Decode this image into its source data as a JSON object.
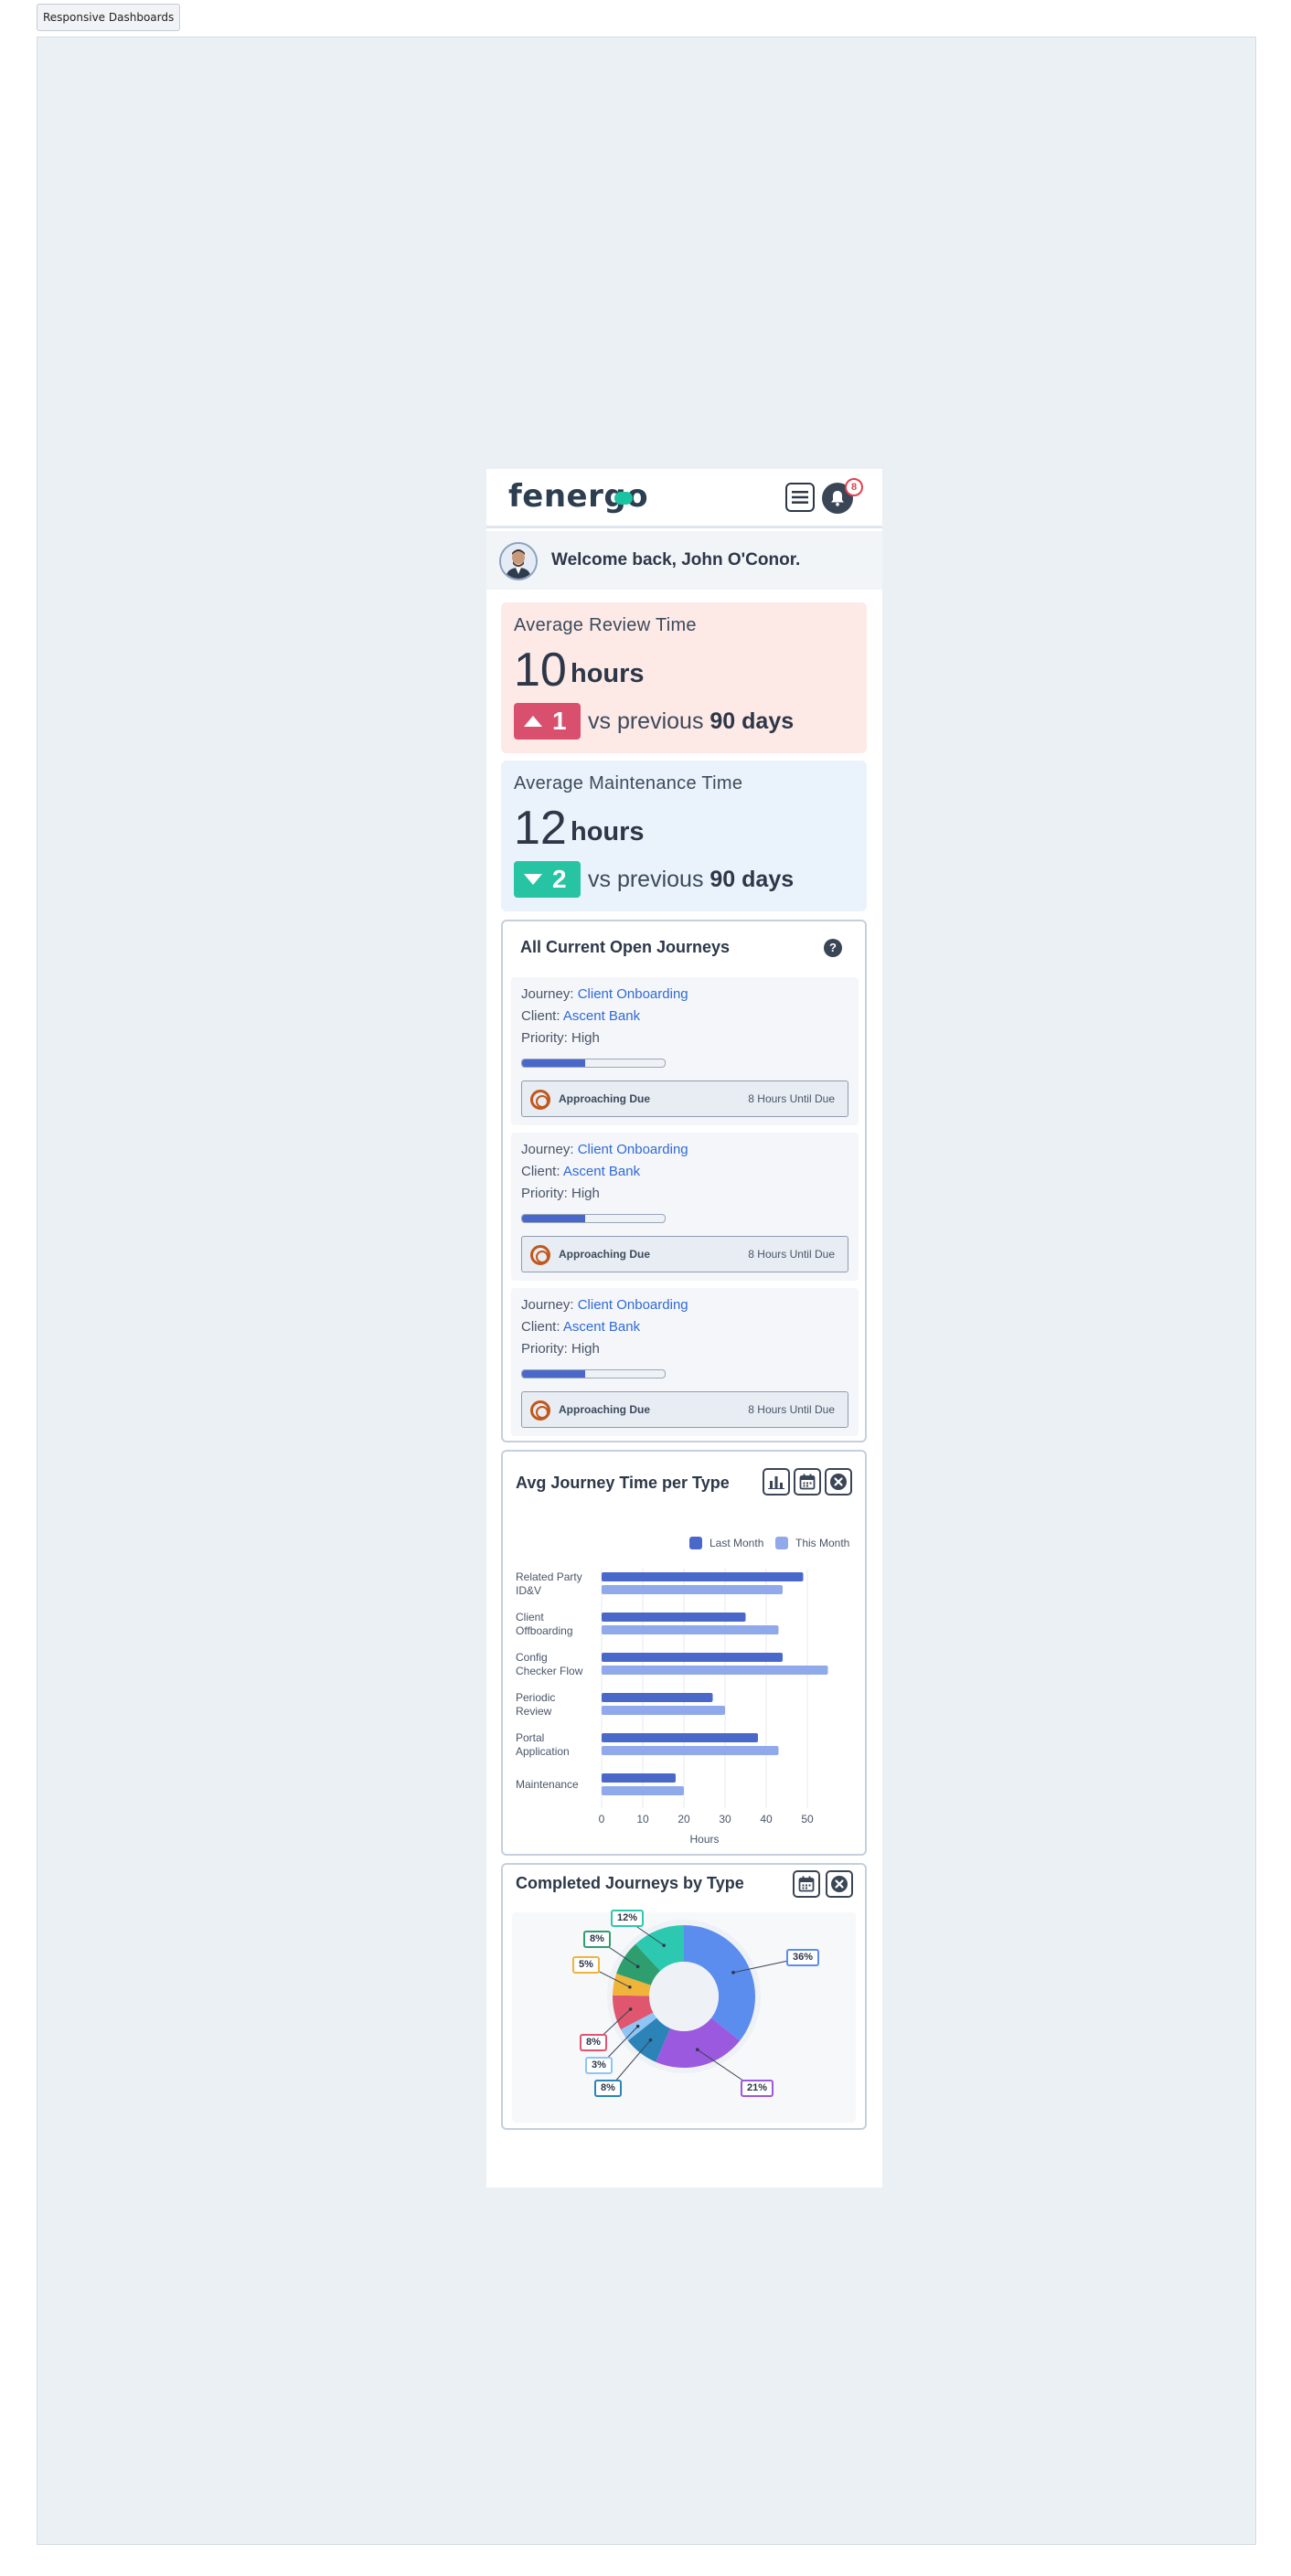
{
  "story_tab": "Responsive Dashboards",
  "header": {
    "logo": "fenergo",
    "notification_count": "8"
  },
  "welcome": {
    "text": "Welcome back, John O'Conor."
  },
  "kpis": [
    {
      "title": "Average Review Time",
      "value": "10",
      "unit": "hours",
      "delta": "1",
      "direction": "up",
      "compare_prefix": "vs previous",
      "compare_bold": "90 days",
      "color": "#d9506f"
    },
    {
      "title": "Average Maintenance Time",
      "value": "12",
      "unit": "hours",
      "delta": "2",
      "direction": "down",
      "compare_prefix": "vs previous",
      "compare_bold": "90 days",
      "color": "#27c4a4"
    }
  ],
  "journeys": {
    "title": "All Current Open Journeys",
    "help": "?",
    "items": [
      {
        "journey_label": "Journey:",
        "journey": "Client Onboarding",
        "client_label": "Client:",
        "client": "Ascent Bank",
        "priority": "Priority: High",
        "progress": 0.44,
        "status": "Approaching Due",
        "time_left": "8 Hours Until Due"
      },
      {
        "journey_label": "Journey:",
        "journey": "Client Onboarding",
        "client_label": "Client:",
        "client": "Ascent Bank",
        "priority": "Priority: High",
        "progress": 0.44,
        "status": "Approaching Due",
        "time_left": "8 Hours Until Due"
      },
      {
        "journey_label": "Journey:",
        "journey": "Client Onboarding",
        "client_label": "Client:",
        "client": "Ascent Bank",
        "priority": "Priority: High",
        "progress": 0.44,
        "status": "Approaching Due",
        "time_left": "8 Hours Until Due"
      }
    ]
  },
  "avg_panel": {
    "title": "Avg Journey Time per Type"
  },
  "completed_panel": {
    "title": "Completed Journeys by Type"
  },
  "chart_data": [
    {
      "type": "bar",
      "orientation": "horizontal",
      "title": "Avg Journey Time per Type",
      "categories": [
        "Related Party ID&V",
        "Client Offboarding",
        "Config Checker Flow",
        "Periodic Review",
        "Portal Application",
        "Maintenance"
      ],
      "category_lines": [
        [
          "Related Party",
          "ID&V"
        ],
        [
          "Client",
          "Offboarding"
        ],
        [
          "Config",
          "Checker Flow"
        ],
        [
          "Periodic",
          "Review"
        ],
        [
          "Portal",
          "Application"
        ],
        [
          "Maintenance"
        ]
      ],
      "series": [
        {
          "name": "Last Month",
          "values": [
            49,
            35,
            44,
            27,
            38,
            18
          ],
          "color": "#4a68c9"
        },
        {
          "name": "This Month",
          "values": [
            44,
            43,
            55,
            30,
            43,
            20
          ],
          "color": "#8fa9ea"
        }
      ],
      "xlabel": "Hours",
      "xlim": [
        0,
        50
      ],
      "xticks": [
        "0",
        "10",
        "20",
        "30",
        "40",
        "50"
      ],
      "legend": "top-right",
      "grid": true
    },
    {
      "type": "pie",
      "title": "Completed Journeys by Type",
      "donut": true,
      "values": [
        36,
        21,
        8,
        3,
        8,
        5,
        8,
        12
      ],
      "labels": [
        "36%",
        "21%",
        "8%",
        "3%",
        "8%",
        "5%",
        "8%",
        "12%"
      ],
      "colors": [
        "#5b8def",
        "#9b59e0",
        "#2b83b8",
        "#8ec5f5",
        "#e0566f",
        "#f0b43a",
        "#2f9e6f",
        "#2cc9b0"
      ]
    }
  ]
}
